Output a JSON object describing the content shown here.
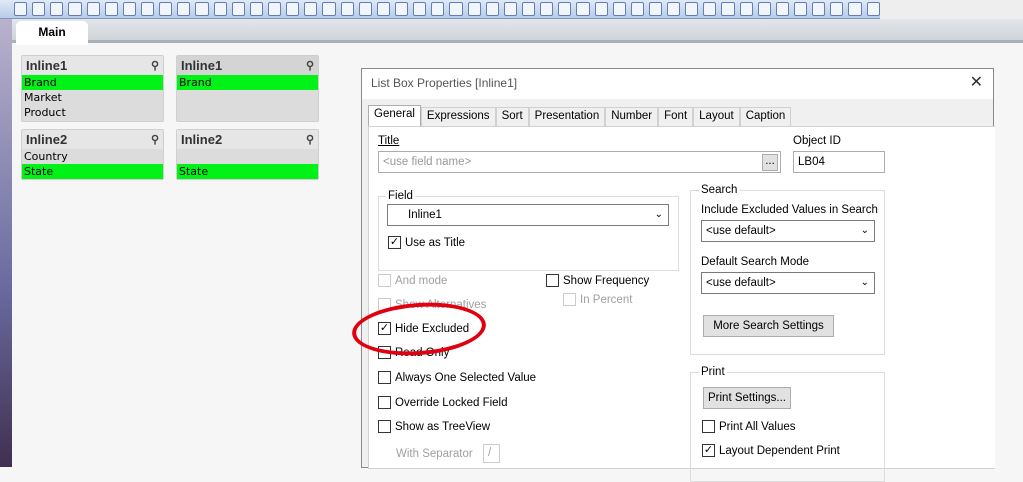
{
  "app": {
    "tab_main": "Main"
  },
  "listboxes": [
    {
      "title": "Inline1",
      "items": [
        {
          "text": "Brand",
          "selected": true
        },
        {
          "text": "Market",
          "selected": false
        },
        {
          "text": "Product",
          "selected": false
        }
      ]
    },
    {
      "title": "Inline1",
      "items": [
        {
          "text": "Brand",
          "selected": true
        }
      ]
    },
    {
      "title": "Inline2",
      "items": [
        {
          "text": "Country",
          "selected": false
        },
        {
          "text": "State",
          "selected": true
        }
      ]
    },
    {
      "title": "Inline2",
      "items": [
        {
          "text": "",
          "selected": false
        },
        {
          "text": "State",
          "selected": true
        }
      ]
    }
  ],
  "dialog": {
    "title": "List Box Properties [Inline1]",
    "tabs": [
      "General",
      "Expressions",
      "Sort",
      "Presentation",
      "Number",
      "Font",
      "Layout",
      "Caption"
    ],
    "title_label": "Title",
    "title_placeholder": "<use field name>",
    "browse": "...",
    "object_id_label": "Object ID",
    "object_id": "LB04",
    "field_group": "Field",
    "field_value": "Inline1",
    "use_as_title": "Use as Title",
    "search_group": "Search",
    "include_excluded_label": "Include Excluded Values in Search",
    "include_excluded_value": "<use default>",
    "default_search_label": "Default Search Mode",
    "default_search_value": "<use default>",
    "more_search": "More Search Settings",
    "and_mode": "And mode",
    "show_alternatives": "Show Alternatives",
    "hide_excluded": "Hide Excluded",
    "read_only": "Read Only",
    "always_one": "Always One Selected Value",
    "override_locked": "Override Locked Field",
    "show_treeview": "Show as TreeView",
    "with_separator": "With Separator",
    "separator": "/",
    "show_frequency": "Show Frequency",
    "in_percent": "In Percent",
    "print_group": "Print",
    "print_settings": "Print Settings...",
    "print_all": "Print All Values",
    "layout_dependent": "Layout Dependent Print"
  },
  "colors": {
    "selected": "#00f216",
    "annotation": "#e00010"
  }
}
